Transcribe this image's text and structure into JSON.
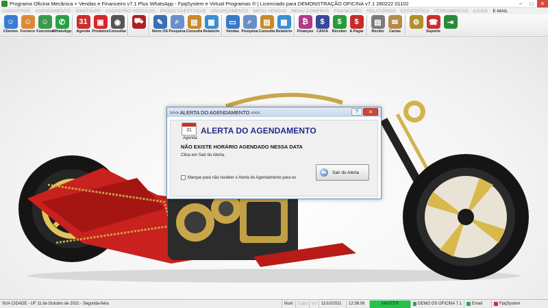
{
  "window": {
    "title": "Programa Oficina Mecânica + Vendas e Financeiro v7.1 Plus WhatsApp - FpqSystem e Virtual Programas ® | Licenciado para  DEMONSTRAÇÃO OFICINA v7.1 280222 01102"
  },
  "menu": [
    {
      "label": "CADASTROS"
    },
    {
      "label": "AGENDAMENTO"
    },
    {
      "label": "WHATSAPP"
    },
    {
      "label": "CADASTRO VEÍCULOS"
    },
    {
      "label": "PRODUTO/ESTOQUE"
    },
    {
      "label": "OS/ORÇAMENTO"
    },
    {
      "label": "MENU VENDAS"
    },
    {
      "label": "MENU COMPRAS"
    },
    {
      "label": "FINANCEIRO"
    },
    {
      "label": "RELATÓRIOS"
    },
    {
      "label": "ESTATÍSTICA"
    },
    {
      "label": "FERRAMENTAS"
    },
    {
      "label": "AJUDA"
    },
    {
      "label": "E-MAIL"
    }
  ],
  "toolbar": [
    {
      "label": "Clientes",
      "icon": "clients-icon",
      "color": "#3a7bd5"
    },
    {
      "label": "Fornece",
      "icon": "supplier-icon",
      "color": "#d98b3a"
    },
    {
      "label": "Funciona",
      "icon": "employee-icon",
      "color": "#3a9a4a"
    },
    {
      "label": "WhatsApp",
      "icon": "whatsapp-icon",
      "color": "#25a244"
    },
    {
      "label": "Agenda",
      "icon": "calendar-icon",
      "color": "#c9302c"
    },
    {
      "label": "Produtos",
      "icon": "products-icon",
      "color": "#d8262a"
    },
    {
      "label": "Consultar",
      "icon": "consult-icon",
      "color": "#555555"
    },
    {
      "label": "",
      "icon": "motorcycle-icon",
      "color": "#b02020"
    },
    {
      "label": "Novo OS",
      "icon": "new-os-icon",
      "color": "#3a6fb5"
    },
    {
      "label": "Pesquisa",
      "icon": "search-doc-icon",
      "color": "#6a8fc9"
    },
    {
      "label": "Consulta",
      "icon": "consult-box-icon",
      "color": "#c98a2a"
    },
    {
      "label": "Relatório",
      "icon": "report-icon",
      "color": "#3a8fd0"
    },
    {
      "label": "Vendas",
      "icon": "sales-icon",
      "color": "#3a79c7"
    },
    {
      "label": "Pesquisa",
      "icon": "search-doc-icon",
      "color": "#6a8fc9"
    },
    {
      "label": "Consulta",
      "icon": "consult-box-icon",
      "color": "#c98a2a"
    },
    {
      "label": "Relatório",
      "icon": "report-icon",
      "color": "#3a8fd0"
    },
    {
      "label": "Finanças",
      "icon": "finance-icon",
      "color": "#b03a8a"
    },
    {
      "label": "CAIXA",
      "icon": "cashbox-icon",
      "color": "#3a4a9a"
    },
    {
      "label": "Receber",
      "icon": "receive-icon",
      "color": "#2a9a3a"
    },
    {
      "label": "A Pagar",
      "icon": "pay-icon",
      "color": "#c92a2a"
    },
    {
      "label": "Recibo",
      "icon": "receipt-icon",
      "color": "#7a7a7a"
    },
    {
      "label": "Cartas",
      "icon": "letters-icon",
      "color": "#b58a4a"
    },
    {
      "label": "",
      "icon": "tools-icon",
      "color": "#b0902a"
    },
    {
      "label": "Suporte",
      "icon": "support-icon",
      "color": "#c9302c"
    },
    {
      "label": "",
      "icon": "exit-icon",
      "color": "#2a8a3a"
    }
  ],
  "dialog": {
    "title": ">>> ALERTA DO AGENDAMENTO <<<",
    "icon_label": "Agenda",
    "heading": "ALERTA DO AGENDAMENTO",
    "message": "NÃO EXISTE HORÁRIO AGENDADO NESSA DATA",
    "instruction": "Clica em Sair do Alerta.",
    "checkbox_label": "Marque para não receber o Alerta do Agendamento para es",
    "exit_button": "Sair do Alerta"
  },
  "statusbar": {
    "location": "SUA CIDADE - UF 11 de Outubro de 2021 - Segunda-feira",
    "num": "Num",
    "caps": "Caps",
    "ins": "Ins",
    "date": "11/10/2021",
    "time": "12:36:06",
    "master": "MASTER",
    "demo": "DEMO OS OFICINA 7.1",
    "email": "Email",
    "fpq": "FpqSystem"
  }
}
